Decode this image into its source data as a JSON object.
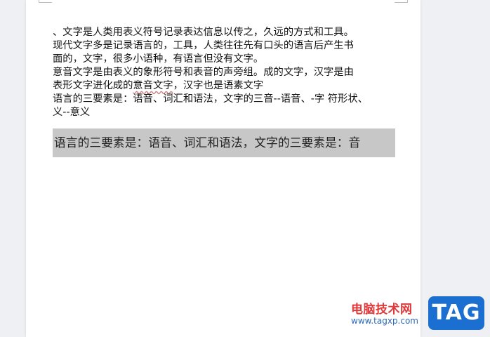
{
  "document": {
    "lines": [
      "、文字是人类用表义符号记录表达信息以传之，久远的方式和工具。",
      "现代文字多是记录语言的，工具，人类往往先有口头的语言后产生书",
      "面的，文字，很多小语种，有语言但没有文字。",
      "意音文字是由表义的象形符号和表音的声旁组。成的文字，汉字是由",
      "表形文字进化成的",
      "意音文字",
      "，汉字也是语素文字",
      "语言的三要素是：语音、词汇和语法，文字的三音--语音、-字  符形状、",
      "义--意义"
    ],
    "highlighted_paragraph": "语言的三要素是：语音、词汇和语法，文字的三要素是：音"
  },
  "watermark": {
    "site_name": "电脑技术网",
    "url": "www.tagxp.com",
    "badge": "TAG"
  },
  "colors": {
    "highlight": "#c7c7c7",
    "watermark_red": "#e0393a",
    "watermark_blue": "#1b6fd1"
  }
}
